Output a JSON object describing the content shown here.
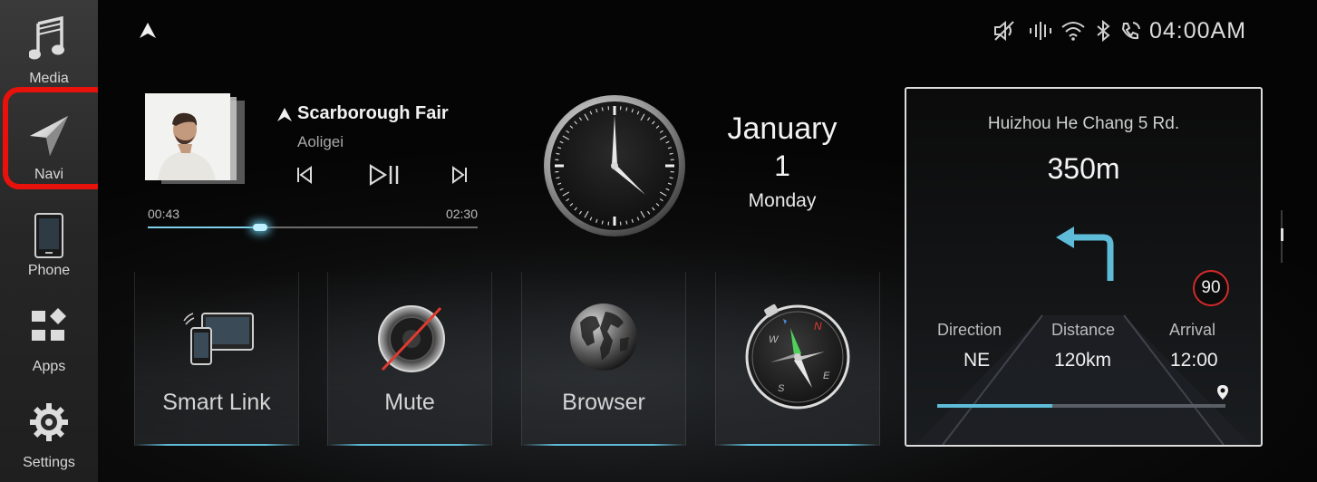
{
  "sidebar": {
    "items": [
      {
        "label": "Media",
        "icon": "music-note-icon"
      },
      {
        "label": "Navi",
        "icon": "navigation-arrow-icon"
      },
      {
        "label": "Phone",
        "icon": "phone-icon"
      },
      {
        "label": "Apps",
        "icon": "apps-grid-icon"
      },
      {
        "label": "Settings",
        "icon": "gear-icon"
      }
    ],
    "highlight_color": "#e8120c"
  },
  "status_bar": {
    "time": "04:00AM",
    "icons": [
      "mute-speaker-icon",
      "signal-icon",
      "wifi-icon",
      "bluetooth-icon",
      "phone-link-icon"
    ]
  },
  "media": {
    "title": "Scarborough Fair",
    "artist": "Aoligei",
    "elapsed": "00:43",
    "duration": "02:30",
    "progress": 0.34,
    "accent": "#5fbcd8"
  },
  "date": {
    "month": "January",
    "day": "1",
    "weekday": "Monday"
  },
  "tiles": [
    {
      "label": "Smart Link",
      "icon": "smart-link-icon"
    },
    {
      "label": "Mute",
      "icon": "mute-speaker-icon"
    },
    {
      "label": "Browser",
      "icon": "globe-icon"
    },
    {
      "label": "",
      "icon": "compass-icon"
    }
  ],
  "navigation": {
    "street": "Huizhou He Chang 5 Rd.",
    "distance_to_turn": "350m",
    "turn": "left",
    "speed_limit": "90",
    "direction_label": "Direction",
    "direction_value": "NE",
    "distance_label": "Distance",
    "distance_value": "120km",
    "arrival_label": "Arrival",
    "arrival_value": "12:00",
    "route_progress": 0.4,
    "arrow_color": "#5fbcd8",
    "limit_color": "#d42a2a"
  }
}
